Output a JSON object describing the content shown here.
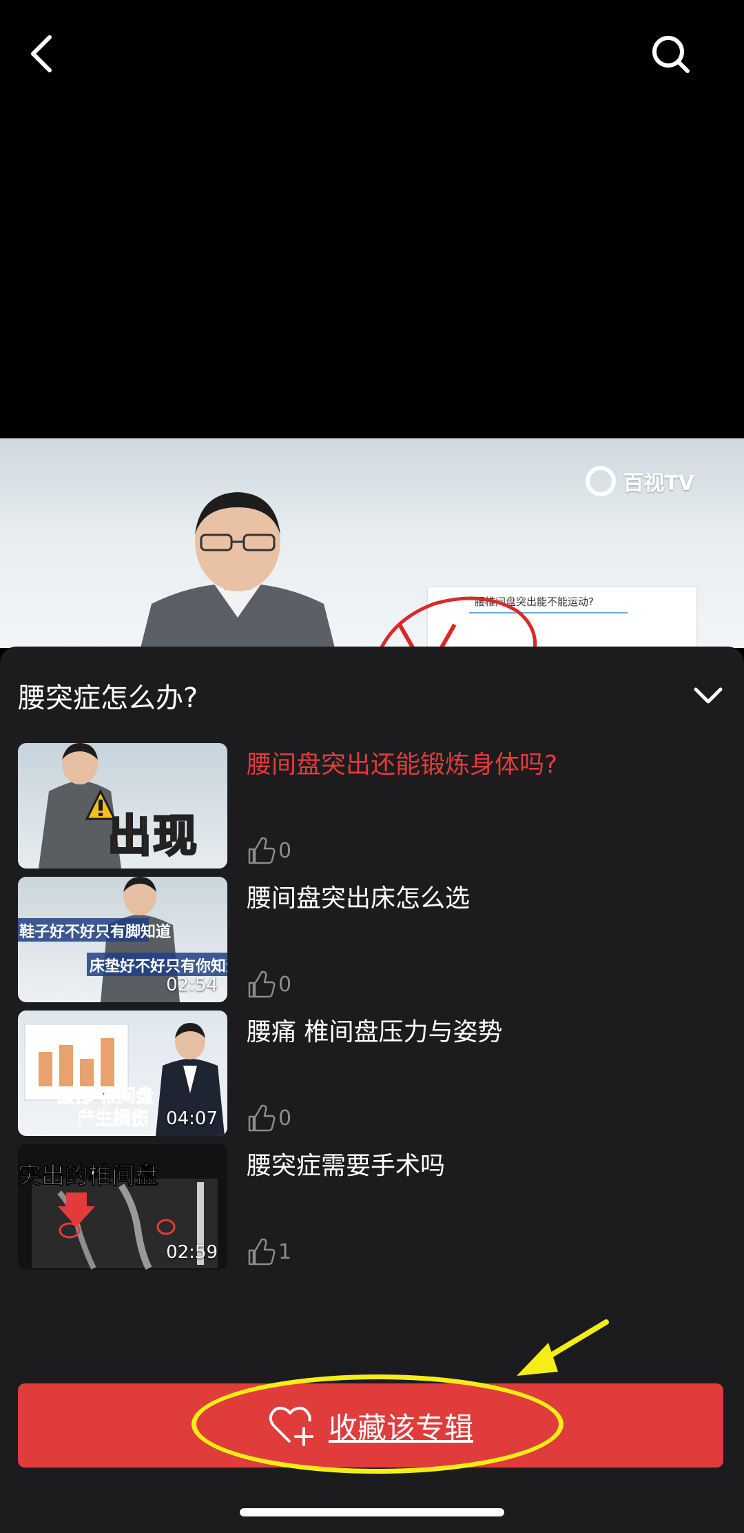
{
  "top_bar": {
    "back_icon": "chevron-left-icon",
    "search_icon": "search-icon"
  },
  "video_preview": {
    "brand": "百视TV",
    "slide_title": "腰椎间盘突出能不能运动?"
  },
  "sheet": {
    "title": "腰突症怎么办?",
    "collapse_icon": "chevron-down-icon"
  },
  "videos": [
    {
      "title": "腰间盘突出还能锻炼身体吗?",
      "duration": "",
      "likes": "0",
      "active": true,
      "thumb_caption": "出现"
    },
    {
      "title": "腰间盘突出床怎么选",
      "duration": "02:54",
      "likes": "0",
      "active": false,
      "thumb_caption_1": "鞋子好不好只有脚知道",
      "thumb_caption_2": "床垫好不好只有你知道"
    },
    {
      "title": "腰痛 椎间盘压力与姿势",
      "duration": "04:07",
      "likes": "0",
      "active": false,
      "thumb_caption_1": "腰部 椎间盘",
      "thumb_caption_2": "产生损伤"
    },
    {
      "title": "腰突症需要手术吗",
      "duration": "02:59",
      "likes": "1",
      "active": false,
      "thumb_caption": "突出的椎间盘"
    }
  ],
  "collect_button": {
    "label": "收藏该专辑",
    "icon": "heart-plus-icon"
  },
  "colors": {
    "accent_red": "#e03c3c",
    "active_title": "#e33b3b",
    "sheet_bg": "#1c1c1e",
    "annotation_yellow": "#f5ee16"
  }
}
